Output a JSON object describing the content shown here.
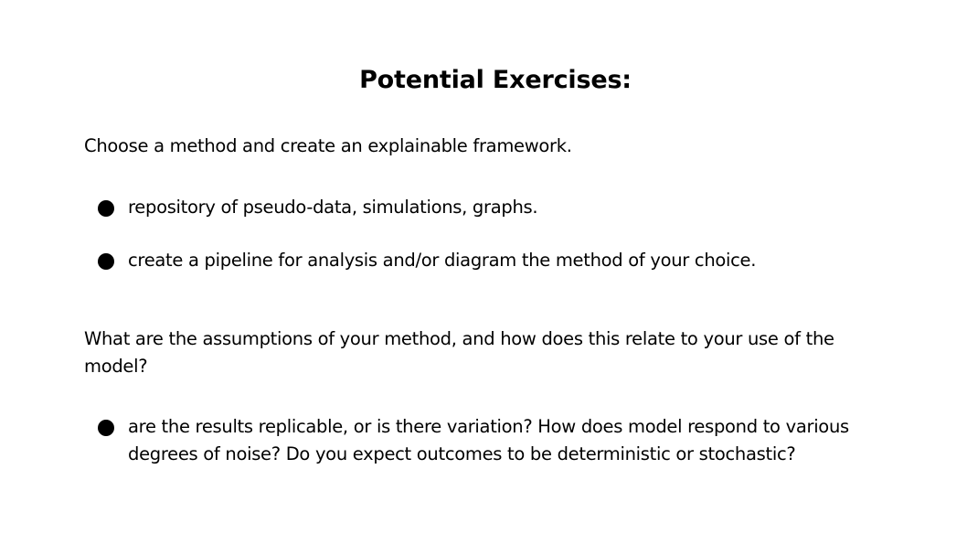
{
  "slide": {
    "title": "Potential Exercises:",
    "section1": {
      "text": "Choose a method and create an explainable framework.",
      "bullets": [
        "repository of pseudo-data, simulations, graphs.",
        "create a pipeline for analysis and/or diagram the method of your choice."
      ]
    },
    "section2": {
      "text": "What are the assumptions of your method, and how does this relate to your use of the model?",
      "bullets": [
        "are the results replicable, or is there variation? How does model respond to various degrees of noise? Do you expect outcomes to be deterministic or stochastic?"
      ]
    }
  }
}
